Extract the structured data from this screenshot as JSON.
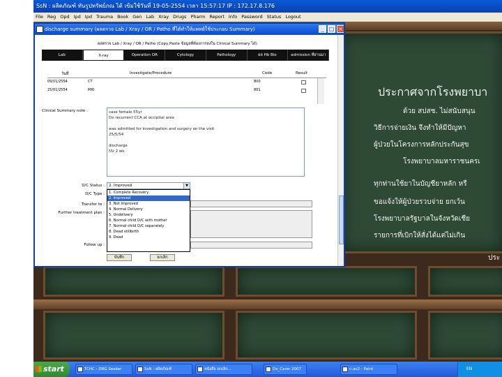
{
  "app": {
    "title": "SsN : ผลิตภัณฑ์ ทันรูปทรัพย์ภณ ได้ เข้มใช้วันที่ 19-05-2554 เวลา 15:57:17 IP : 172.17.8.176",
    "menu": [
      "File",
      "Reg",
      "Opd",
      "Ipd",
      "Ipd",
      "Trauma",
      "Book",
      "Gen",
      "Lab",
      "Xray",
      "Drugs",
      "Pharm",
      "Report",
      "Info",
      "Password",
      "Status",
      "Logout"
    ]
  },
  "dialog": {
    "title": "discharge summary (ผลตรวจ Lab / Xray / OR / Patho ที่ได้ทำให้แพทย์ใช้ประกอบ Summary)",
    "header_line": "ผลตรวจ Lab / Xray / OR / Patho (Copy,Paste ข้อมูลที่ต้องการลงใน Clinical Summary ได้)",
    "tabs": [
      {
        "label": "Lab",
        "active": false
      },
      {
        "label": "X-ray",
        "active": true
      },
      {
        "label": "Operation OR",
        "active": false
      },
      {
        "label": "Cytology",
        "active": false
      },
      {
        "label": "Pathology",
        "active": false
      },
      {
        "label": "ผล Hb Bio",
        "active": false
      },
      {
        "label": "admission ที่ผ่านมา",
        "active": false
      }
    ],
    "procedures": {
      "headers": {
        "date": "วันที่",
        "investigate": "Investigate/Procedure",
        "code": "Code",
        "result": "Result"
      },
      "rows": [
        {
          "date": "09/01/2554",
          "investigate": "CT",
          "code": "800"
        },
        {
          "date": "25/01/2554",
          "investigate": "MRI",
          "code": "801"
        }
      ]
    },
    "clinical_summary_label": "Clinical Summary note :",
    "clinical_notes": [
      "case female 55yr",
      "Dx recurrent CCA at occipital area",
      "",
      "was admitted for investigation and surgery on the visit",
      "25/5/54",
      "",
      "discharge",
      "f/U 2 wk"
    ],
    "dc_status_label": "D/C Status :",
    "dc_status_value": "2. Improved",
    "dc_type_label": "D/C Type :",
    "transfer_label": "Transfer to :",
    "further_plan_label": "Further treatment plan :",
    "follow_up_label": "Follow up :",
    "dc_status_options": [
      {
        "label": "1. Complete Recovery",
        "selected": false
      },
      {
        "label": "2. Improved",
        "selected": true
      },
      {
        "label": "3. Not Improved",
        "selected": false
      },
      {
        "label": "4. Normal Delivery",
        "selected": false
      },
      {
        "label": "5. Undelivery",
        "selected": false
      },
      {
        "label": "6. Normal child D/C with mother",
        "selected": false
      },
      {
        "label": "7. Normal child D/C separately",
        "selected": false
      },
      {
        "label": "8. Dead stillbirth",
        "selected": false
      },
      {
        "label": "9. Dead",
        "selected": false
      }
    ],
    "save_button": "บันทึก",
    "cancel_button": "ยกเลิก"
  },
  "background_text": [
    "ประกาศจากโรงพยาบา",
    "ด้วย สปสช. ไม่สนับสนุน",
    "วิธีการจ่ายเงิน จึงทำให้มีปัญหา",
    "ผู้ป่วยในโครงการหลักประกันสุข",
    "โรงพยาบาลมหาราชนครเ",
    "ทุกท่านใช้ยาในบัญชียาหลัก หรื",
    "ขอแจ้งให้ผู้ป่วยรวบจ่าย ยกเว้น",
    "โรงพยาบาลรัฐบาลในจังหวัดเชีย",
    "รายการที่เบิกให้สั่งได้แต่ไม่เกิน",
    "ประ"
  ],
  "taskbar": {
    "start_label": "start",
    "tasks": [
      "TCHC - DRG Seeker",
      "SsN : ผลิตภัณฑ์",
      "หนังสือ ยกเลิก...",
      "Dx_Carer 2007",
      "n.ac2 - Paint"
    ],
    "language": "EN"
  }
}
